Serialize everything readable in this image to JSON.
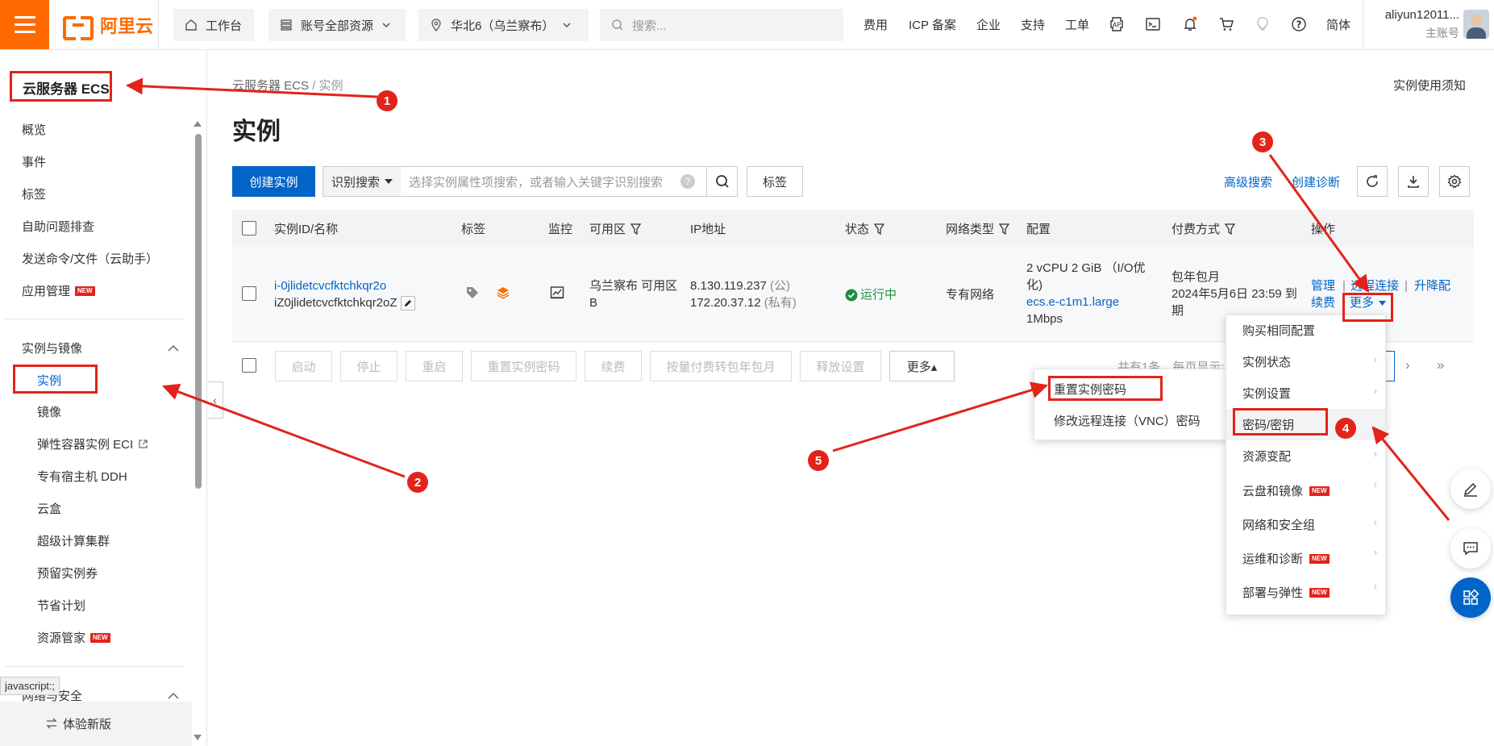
{
  "topbar": {
    "logo_text": "阿里云",
    "workbench": "工作台",
    "resources": "账号全部资源",
    "region": "华北6（乌兰察布）",
    "search_placeholder": "搜索...",
    "nav": [
      "费用",
      "ICP 备案",
      "企业",
      "支持",
      "工单"
    ],
    "lang": "简体",
    "username": "aliyun12011...",
    "role": "主账号"
  },
  "sidebar": {
    "title": "云服务器 ECS",
    "items": [
      "概览",
      "事件",
      "标签",
      "自助问题排查",
      "发送命令/文件（云助手）",
      "应用管理"
    ],
    "group1": "实例与镜像",
    "group1_items": [
      "实例",
      "镜像",
      "弹性容器实例 ECI",
      "专有宿主机 DDH",
      "云盒",
      "超级计算集群",
      "预留实例券",
      "节省计划",
      "资源管家"
    ],
    "group2": "网络与安全",
    "bottom": "体验新版",
    "new_tag": "NEW",
    "status_url": "javascript:;"
  },
  "main": {
    "breadcrumb": [
      "云服务器 ECS",
      "实例"
    ],
    "breadcrumb_sep": "/",
    "notice": "实例使用须知",
    "title": "实例",
    "create_button": "创建实例",
    "search_select": "识别搜索",
    "search_placeholder": "选择实例属性项搜索，或者输入关键字识别搜索",
    "tag_button": "标签",
    "advanced_search": "高级搜索",
    "create_diag": "创建诊断"
  },
  "table": {
    "headers": [
      "实例ID/名称",
      "标签",
      "监控",
      "可用区",
      "IP地址",
      "状态",
      "网络类型",
      "配置",
      "付费方式",
      "操作"
    ],
    "row": {
      "id": "i-0jlidetcvcfktchkqr2o",
      "name": "iZ0jlidetcvcfktchkqr2oZ",
      "zone1": "乌兰察布 可用区",
      "zone2": "B",
      "ip_public": "8.130.119.237",
      "ip_public_tag": "(公)",
      "ip_private": "172.20.37.12",
      "ip_private_tag": "(私有)",
      "status": "运行中",
      "network": "专有网络",
      "config1": "2 vCPU 2 GiB （I/O优",
      "config2": "化)",
      "config3": "ecs.e-c1m1.large",
      "config4": "1Mbps",
      "pay1": "包年包月",
      "pay2": "2024年5月6日 23:59 到",
      "pay3": "期",
      "ops": [
        "管理",
        "远程连接",
        "升降配",
        "续费",
        "更多"
      ],
      "ops_sep": "|"
    }
  },
  "bottombar": {
    "buttons": [
      "启动",
      "停止",
      "重启",
      "重置实例密码",
      "续费",
      "按量付费转包年包月",
      "释放设置"
    ],
    "more": "更多▴",
    "pager": "共有1条，每页显示:"
  },
  "more_menu": {
    "items": [
      "购买相同配置",
      "实例状态",
      "实例设置",
      "密码/密钥",
      "资源变配",
      "云盘和镜像",
      "网络和安全组",
      "运维和诊断",
      "部署与弹性"
    ]
  },
  "password_submenu": {
    "items": [
      "重置实例密码",
      "修改远程连接（VNC）密码"
    ]
  },
  "annotations": [
    "1",
    "2",
    "3",
    "4",
    "5"
  ],
  "colors": {
    "brand": "#ff6a00",
    "primary": "#0064c8",
    "annotation": "#e2231a",
    "running": "#1e8e3e"
  }
}
